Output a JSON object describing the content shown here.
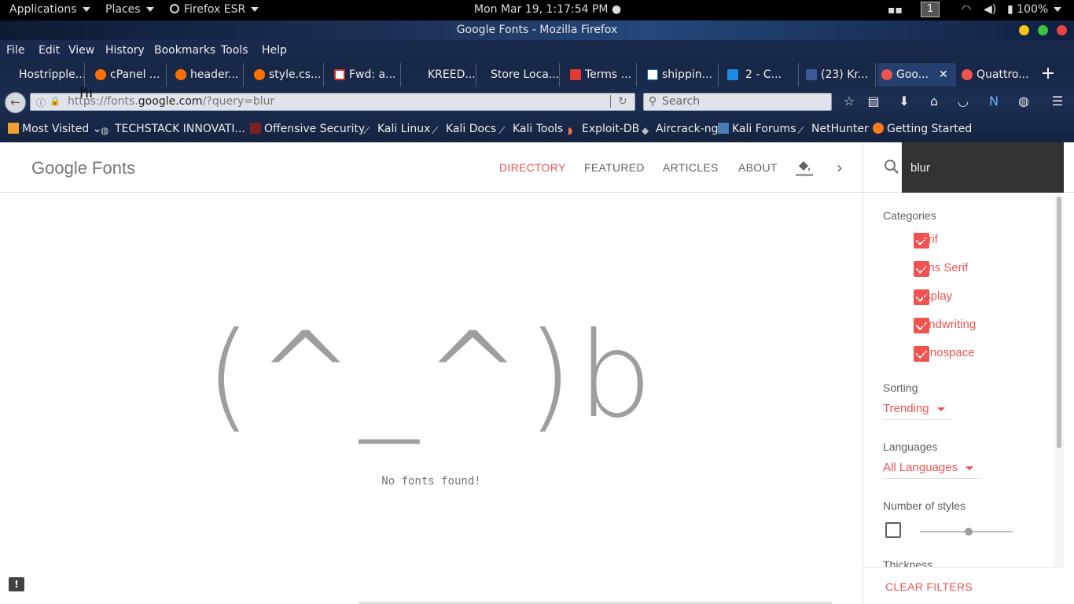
{
  "topbar": {
    "applications": "Applications",
    "places": "Places",
    "firefox": "Firefox ESR",
    "datetime": "Mon Mar 19,  1:17:54 PM",
    "workspace": "1",
    "battery": "100%"
  },
  "window": {
    "title": "Google Fonts - Mozilla Firefox"
  },
  "menu": [
    "File",
    "Edit",
    "View",
    "History",
    "Bookmarks",
    "Tools",
    "Help"
  ],
  "tabs": [
    {
      "label": "Hostripple...",
      "color": "#1565c0"
    },
    {
      "label": "cPanel ...",
      "color": "#ff6f00"
    },
    {
      "label": "header...",
      "color": "#ff6f00"
    },
    {
      "label": "style.cs...",
      "color": "#ff6f00"
    },
    {
      "label": "Fwd: a...",
      "color": "#d32f2f"
    },
    {
      "label": "KREED...",
      "color": "#000000"
    },
    {
      "label": "Store Loca...",
      "color": "#ffffff"
    },
    {
      "label": "Terms ...",
      "color": "#e53935"
    },
    {
      "label": "shippin...",
      "color": "#ffffff"
    },
    {
      "label": "2 - C...",
      "color": "#1e88e5"
    },
    {
      "label": "(23) Kr...",
      "color": "#3b5998"
    },
    {
      "label": "Goo...",
      "color": "#ef5350"
    },
    {
      "label": "Quattro...",
      "color": "#ef5350"
    }
  ],
  "nav": {
    "url_prefix": "https://fonts.",
    "url_domain": "google.com",
    "url_path": "/?query=blur",
    "search_placeholder": "Search",
    "overlay_text": "hi"
  },
  "bookmarks": [
    "Most Visited",
    "TECHSTACK INNOVATI...",
    "Offensive Security",
    "Kali Linux",
    "Kali Docs",
    "Kali Tools",
    "Exploit-DB",
    "Aircrack-ng",
    "Kali Forums",
    "NetHunter",
    "Getting Started"
  ],
  "gf": {
    "logo": "Google Fonts",
    "nav": [
      "DIRECTORY",
      "FEATURED",
      "ARTICLES",
      "ABOUT"
    ],
    "search_value": "blur",
    "emoticon": "(^_^)b",
    "empty_message": "No fonts found!",
    "feedback_icon": "!"
  },
  "sidebar": {
    "categories_title": "Categories",
    "categories": [
      "Serif",
      "Sans Serif",
      "Display",
      "Handwriting",
      "Monospace"
    ],
    "sorting_title": "Sorting",
    "sorting_value": "Trending",
    "languages_title": "Languages",
    "languages_value": "All Languages",
    "styles_title": "Number of styles",
    "thickness_title": "Thickness",
    "clear_label": "CLEAR FILTERS"
  },
  "colors": {
    "accent": "#ef5350",
    "topbar": "#000000",
    "search_bg": "#333333"
  }
}
